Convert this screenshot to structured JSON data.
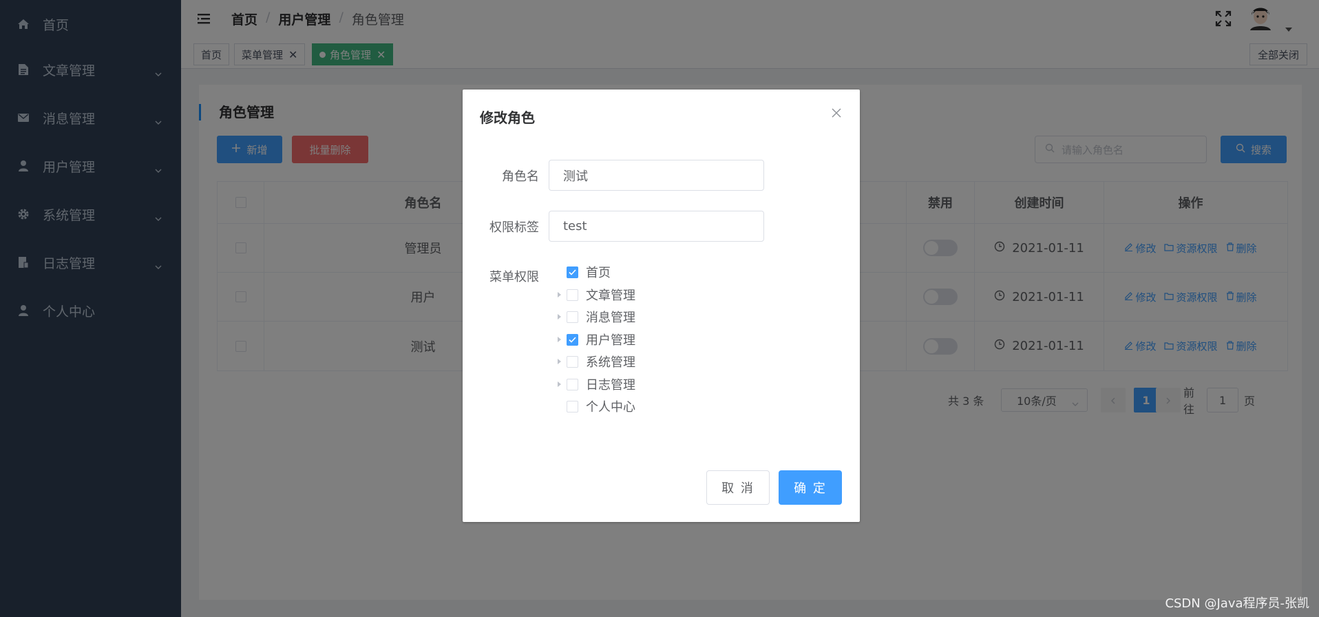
{
  "sidebar": {
    "items": [
      {
        "label": "首页",
        "icon": "home-icon",
        "has_children": false
      },
      {
        "label": "文章管理",
        "icon": "document-icon",
        "has_children": true
      },
      {
        "label": "消息管理",
        "icon": "mail-icon",
        "has_children": true
      },
      {
        "label": "用户管理",
        "icon": "user-icon",
        "has_children": true
      },
      {
        "label": "系统管理",
        "icon": "gear-icon",
        "has_children": true
      },
      {
        "label": "日志管理",
        "icon": "log-icon",
        "has_children": true
      },
      {
        "label": "个人中心",
        "icon": "person-icon",
        "has_children": false
      }
    ]
  },
  "header": {
    "breadcrumb": [
      "首页",
      "用户管理",
      "角色管理"
    ],
    "separator": "/"
  },
  "tags": {
    "items": [
      {
        "label": "首页",
        "closable": false,
        "active": false
      },
      {
        "label": "菜单管理",
        "closable": true,
        "active": false
      },
      {
        "label": "角色管理",
        "closable": true,
        "active": true
      }
    ],
    "close_all": "全部关闭",
    "close_glyph": "✕"
  },
  "page": {
    "title": "角色管理",
    "add_button": "新增",
    "batch_delete_button": "批量删除",
    "search_placeholder": "请输入角色名",
    "search_button": "搜索"
  },
  "table": {
    "headers": {
      "name": "角色名",
      "disabled": "禁用",
      "created": "创建时间",
      "actions": "操作"
    },
    "rows": [
      {
        "name": "管理员",
        "disabled": false,
        "created": "2021-01-11"
      },
      {
        "name": "用户",
        "disabled": false,
        "created": "2021-01-11"
      },
      {
        "name": "测试",
        "disabled": false,
        "created": "2021-01-11"
      }
    ],
    "actions": {
      "edit": "修改",
      "resource": "资源权限",
      "delete": "删除"
    }
  },
  "pagination": {
    "total": "共 3 条",
    "page_size": "10条/页",
    "current_page": "1",
    "goto_label": "前往",
    "goto_value": "1",
    "page_suffix": "页"
  },
  "dialog": {
    "title": "修改角色",
    "role_name_label": "角色名",
    "role_name_value": "测试",
    "perm_label_label": "权限标签",
    "perm_label_value": "test",
    "menu_perm_label": "菜单权限",
    "tree": [
      {
        "label": "首页",
        "expandable": false,
        "checked": true
      },
      {
        "label": "文章管理",
        "expandable": true,
        "checked": false
      },
      {
        "label": "消息管理",
        "expandable": true,
        "checked": false
      },
      {
        "label": "用户管理",
        "expandable": true,
        "checked": true
      },
      {
        "label": "系统管理",
        "expandable": true,
        "checked": false
      },
      {
        "label": "日志管理",
        "expandable": true,
        "checked": false
      },
      {
        "label": "个人中心",
        "expandable": false,
        "checked": false
      }
    ],
    "cancel_button": "取 消",
    "ok_button": "确 定"
  },
  "watermark": "CSDN @Java程序员-张凯",
  "colors": {
    "sidebar_bg": "#304156",
    "primary": "#409eff",
    "danger": "#f56c6c",
    "tag_active": "#42b983"
  }
}
